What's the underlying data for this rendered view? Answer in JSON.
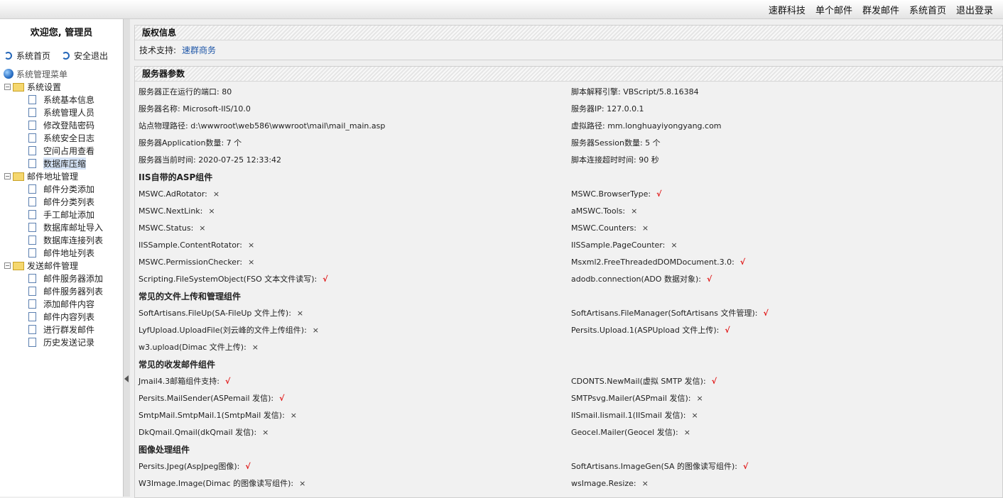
{
  "topnav": [
    "速群科技",
    "单个邮件",
    "群发邮件",
    "系统首页",
    "退出登录"
  ],
  "sidebar": {
    "welcome": "欢迎您, 管理员",
    "quick": [
      "系统首页",
      "安全退出"
    ],
    "root": "系统管理菜单",
    "groups": [
      {
        "label": "系统设置",
        "items": [
          "系统基本信息",
          "系统管理人员",
          "修改登陆密码",
          "系统安全日志",
          "空间占用查看",
          "数据库压缩"
        ]
      },
      {
        "label": "邮件地址管理",
        "items": [
          "邮件分类添加",
          "邮件分类列表",
          "手工邮址添加",
          "数据库邮址导入",
          "数据库连接列表",
          "邮件地址列表"
        ]
      },
      {
        "label": "发送邮件管理",
        "items": [
          "邮件服务器添加",
          "邮件服务器列表",
          "添加邮件内容",
          "邮件内容列表",
          "进行群发邮件",
          "历史发送记录"
        ]
      }
    ],
    "active_item": "数据库压缩"
  },
  "copyright": {
    "title": "版权信息",
    "support_label": "技术支持:",
    "support_link": "速群商务"
  },
  "server": {
    "title": "服务器参数",
    "info_rows": [
      [
        "服务器正在运行的端口: 80",
        "脚本解释引擎: VBScript/5.8.16384"
      ],
      [
        "服务器名称: Microsoft-IIS/10.0",
        "服务器IP: 127.0.0.1"
      ],
      [
        "站点物理路径: d:\\wwwroot\\web586\\wwwroot\\mail\\mail_main.asp",
        "虚拟路径: mm.longhuayiyongyang.com"
      ],
      [
        "服务器Application数量: 7 个",
        "服务器Session数量: 5 个"
      ],
      [
        "服务器当前时间: 2020-07-25 12:33:42",
        "脚本连接超时时间: 90 秒"
      ]
    ],
    "sections": [
      {
        "title": "IIS自带的ASP组件",
        "rows": [
          [
            [
              "MSWC.AdRotator:",
              "×"
            ],
            [
              "MSWC.BrowserType:",
              "√"
            ]
          ],
          [
            [
              "MSWC.NextLink:",
              "×"
            ],
            [
              "aMSWC.Tools:",
              "×"
            ]
          ],
          [
            [
              "MSWC.Status:",
              "×"
            ],
            [
              "MSWC.Counters:",
              "×"
            ]
          ],
          [
            [
              "IISSample.ContentRotator:",
              "×"
            ],
            [
              "IISSample.PageCounter:",
              "×"
            ]
          ],
          [
            [
              "MSWC.PermissionChecker:",
              "×"
            ],
            [
              "Msxml2.FreeThreadedDOMDocument.3.0:",
              "√"
            ]
          ],
          [
            [
              "Scripting.FileSystemObject(FSO 文本文件读写):",
              "√"
            ],
            [
              "adodb.connection(ADO 数据对象):",
              "√"
            ]
          ]
        ]
      },
      {
        "title": "常见的文件上传和管理组件",
        "rows": [
          [
            [
              "SoftArtisans.FileUp(SA-FileUp 文件上传):",
              "×"
            ],
            [
              "SoftArtisans.FileManager(SoftArtisans 文件管理):",
              "√"
            ]
          ],
          [
            [
              "LyfUpload.UploadFile(刘云峰的文件上传组件):",
              "×"
            ],
            [
              "Persits.Upload.1(ASPUpload 文件上传):",
              "√"
            ]
          ],
          [
            [
              "w3.upload(Dimac 文件上传):",
              "×"
            ],
            [
              "",
              ""
            ]
          ]
        ]
      },
      {
        "title": "常见的收发邮件组件",
        "rows": [
          [
            [
              "Jmail4.3邮箱组件支持:",
              "√"
            ],
            [
              "CDONTS.NewMail(虚拟 SMTP 发信):",
              "√"
            ]
          ],
          [
            [
              "Persits.MailSender(ASPemail 发信):",
              "√"
            ],
            [
              "SMTPsvg.Mailer(ASPmail 发信):",
              "×"
            ]
          ],
          [
            [
              "SmtpMail.SmtpMail.1(SmtpMail 发信):",
              "×"
            ],
            [
              "IISmail.Iismail.1(IISmail 发信):",
              "×"
            ]
          ],
          [
            [
              "DkQmail.Qmail(dkQmail 发信):",
              "×"
            ],
            [
              "Geocel.Mailer(Geocel 发信):",
              "×"
            ]
          ]
        ]
      },
      {
        "title": "图像处理组件",
        "rows": [
          [
            [
              "Persits.Jpeg(AspJpeg图像):",
              "√"
            ],
            [
              "SoftArtisans.ImageGen(SA 的图像读写组件):",
              "√"
            ]
          ],
          [
            [
              "W3Image.Image(Dimac 的图像读写组件):",
              "×"
            ],
            [
              "wsImage.Resize:",
              "×"
            ]
          ]
        ]
      }
    ]
  }
}
